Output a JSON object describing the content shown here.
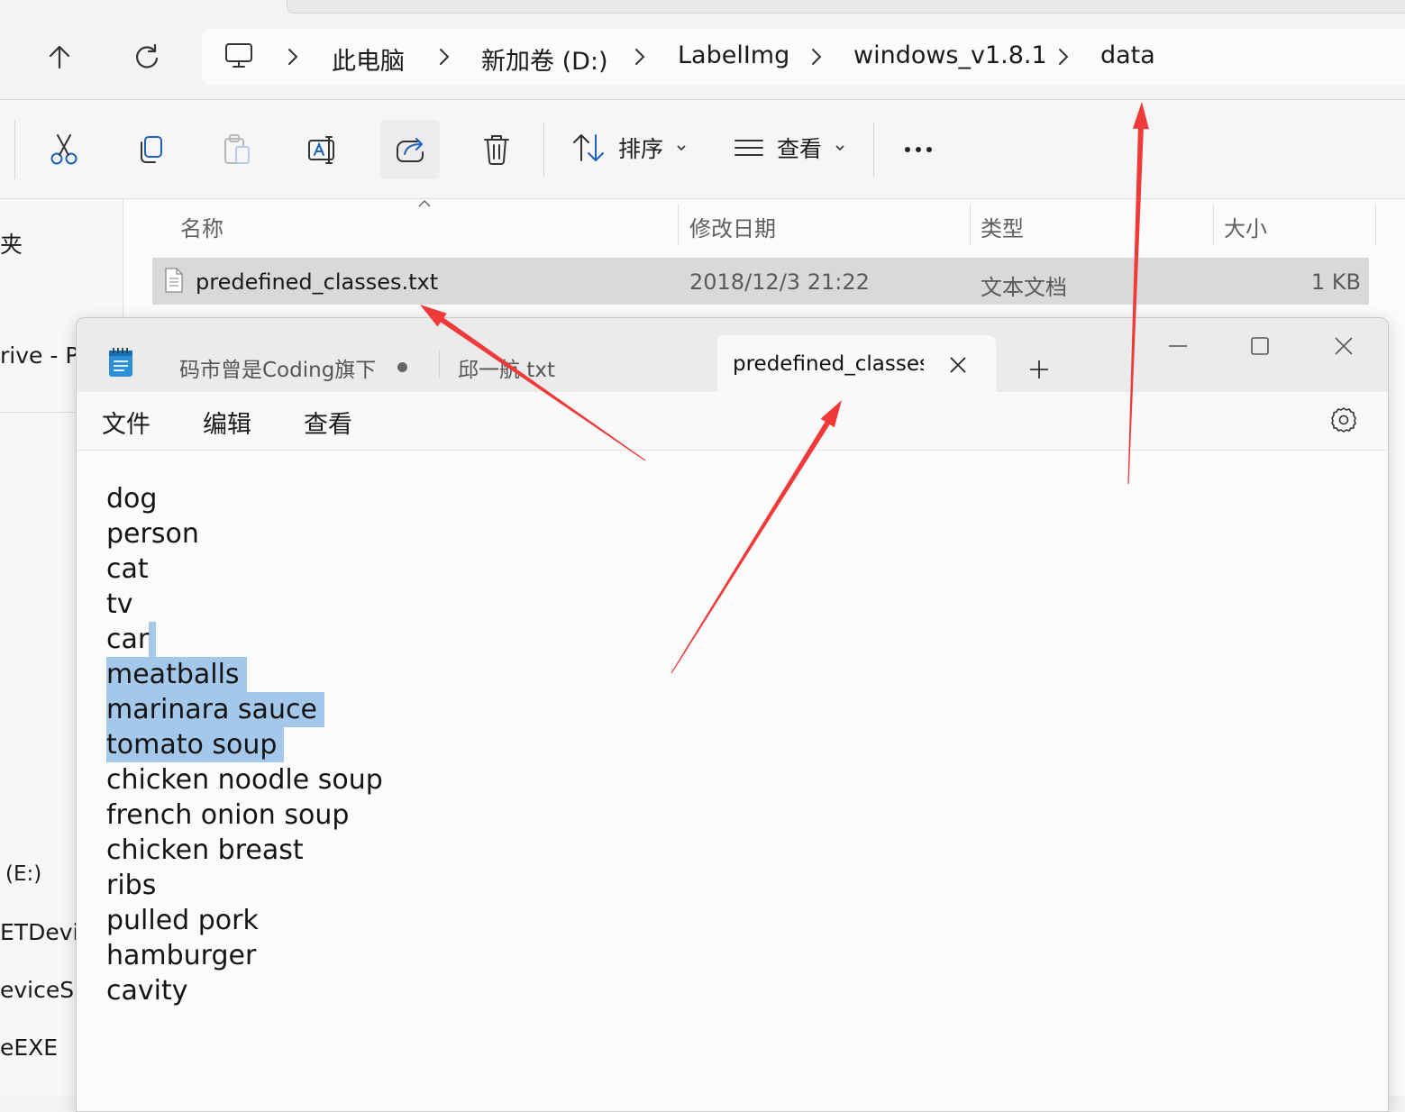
{
  "explorer": {
    "nav": {
      "up_icon": "arrow-up-icon",
      "refresh_icon": "refresh-icon"
    },
    "breadcrumb": [
      "此电脑",
      "新加卷 (D:)",
      "LabelImg",
      "windows_v1.8.1",
      "data"
    ],
    "toolbar": {
      "sort_label": "排序",
      "view_label": "查看"
    },
    "columns": {
      "name": "名称",
      "modified": "修改日期",
      "type": "类型",
      "size": "大小"
    },
    "file": {
      "name": "predefined_classes.txt",
      "modified": "2018/12/3 21:22",
      "type": "文本文档",
      "size": "1 KB"
    },
    "sidebar_items": [
      "夹",
      "rive - Pe",
      "(E:)",
      "ETDevic",
      "eviceSDI",
      "eEXE"
    ]
  },
  "notepad": {
    "tabs": [
      {
        "label": "码市曾是Coding旗下",
        "unsaved": true
      },
      {
        "label": "邱一航.txt"
      },
      {
        "label": "predefined_classes.",
        "active": true
      }
    ],
    "menu": {
      "file": "文件",
      "edit": "编辑",
      "view": "查看"
    },
    "lines": [
      "dog",
      "person",
      "cat",
      "tv",
      "car",
      "meatballs",
      "marinara sauce",
      "tomato soup",
      "chicken noodle soup",
      "french onion soup",
      "chicken breast",
      "ribs",
      "pulled pork",
      "hamburger",
      "cavity"
    ],
    "selected_lines": [
      "meatballs",
      "marinara sauce",
      "tomato soup"
    ],
    "selection_color": "#a4c8ea"
  },
  "annotations": {
    "arrow_color": "#f03a3a"
  }
}
